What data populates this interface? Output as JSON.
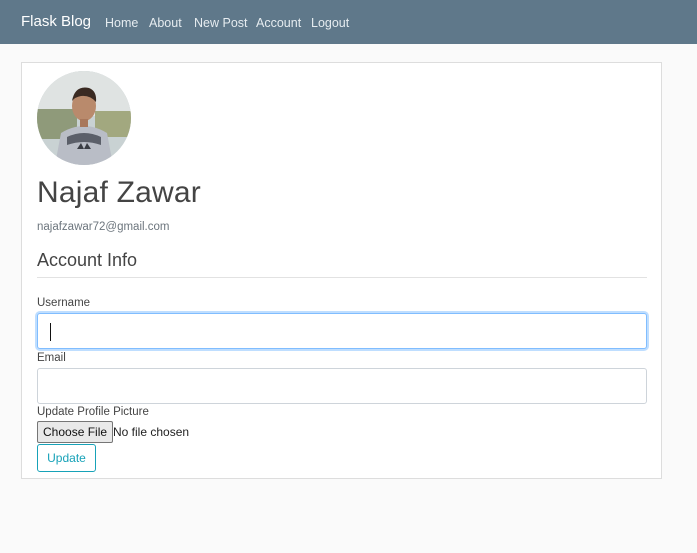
{
  "navbar": {
    "brand": "Flask Blog",
    "links": [
      "Home",
      "About",
      "New Post",
      "Account",
      "Logout"
    ]
  },
  "profile": {
    "name": "Najaf Zawar",
    "email": "najafzawar72@gmail.com"
  },
  "form": {
    "legend": "Account Info",
    "username_label": "Username",
    "username_value": "",
    "email_label": "Email",
    "email_value": "",
    "picture_label": "Update Profile Picture",
    "choose_file_label": "Choose File",
    "file_status": "No file chosen",
    "submit_label": "Update"
  },
  "colors": {
    "navbar": "#5f788a",
    "accent": "#17a2b8"
  }
}
